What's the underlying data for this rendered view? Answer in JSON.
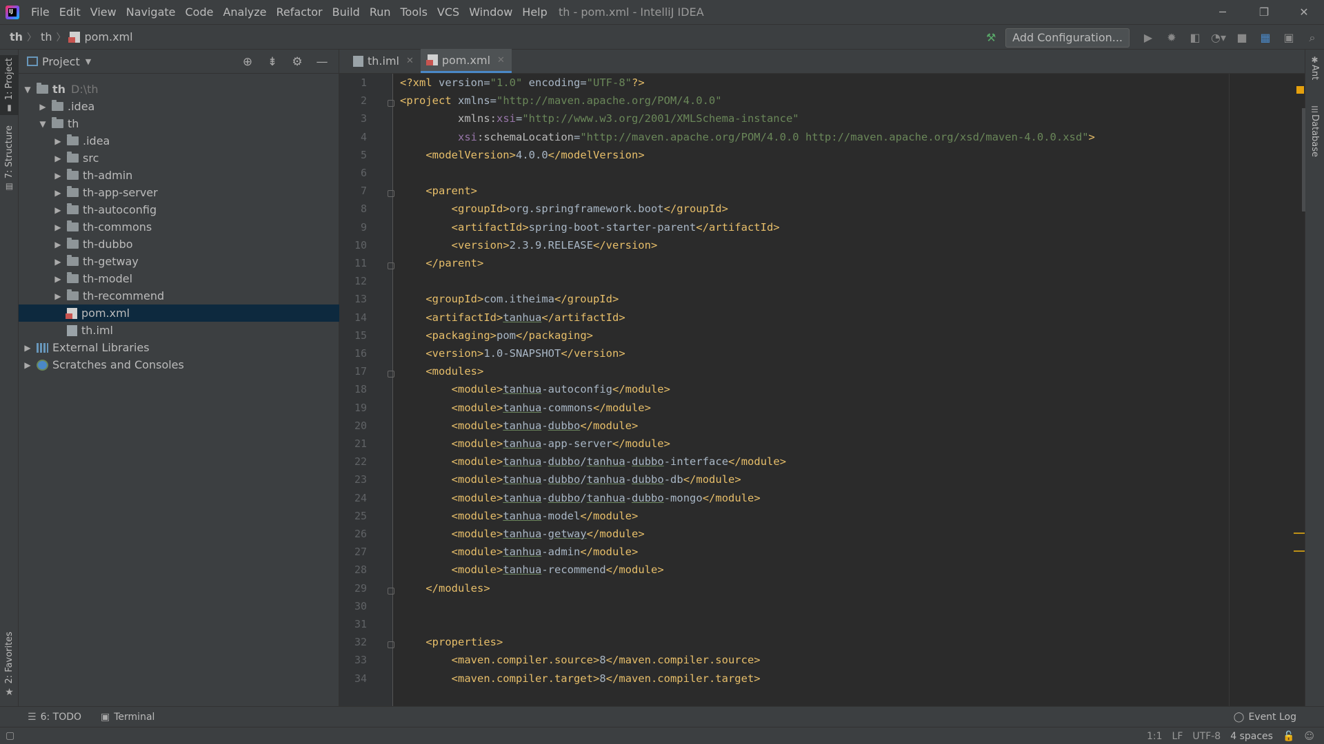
{
  "window": {
    "title": "th - pom.xml - IntelliJ IDEA",
    "logo_text": "IJ",
    "controls": [
      "─",
      "❐",
      "✕"
    ]
  },
  "menu": [
    {
      "label": "File"
    },
    {
      "label": "Edit"
    },
    {
      "label": "View"
    },
    {
      "label": "Navigate"
    },
    {
      "label": "Code"
    },
    {
      "label": "Analyze"
    },
    {
      "label": "Refactor"
    },
    {
      "label": "Build"
    },
    {
      "label": "Run"
    },
    {
      "label": "Tools"
    },
    {
      "label": "VCS"
    },
    {
      "label": "Window"
    },
    {
      "label": "Help"
    }
  ],
  "breadcrumb": {
    "root": "th",
    "folder": "th",
    "file": "pom.xml"
  },
  "toolbar": {
    "add_configuration": "Add Configuration..."
  },
  "left_strip": {
    "project": "1: Project",
    "structure": "7: Structure",
    "favorites": "2: Favorites"
  },
  "right_strip": {
    "ant": "Ant",
    "database": "Database"
  },
  "project_panel": {
    "title": "Project",
    "tree": [
      {
        "label": "th",
        "hint": "D:\\th",
        "type": "folder",
        "level": 0,
        "expanded": true
      },
      {
        "label": ".idea",
        "type": "folder",
        "level": 1,
        "expanded": false
      },
      {
        "label": "th",
        "type": "folder",
        "level": 1,
        "expanded": true
      },
      {
        "label": ".idea",
        "type": "folder",
        "level": 2,
        "expanded": false
      },
      {
        "label": "src",
        "type": "folder",
        "level": 2,
        "expanded": false
      },
      {
        "label": "th-admin",
        "type": "folder",
        "level": 2,
        "expanded": false
      },
      {
        "label": "th-app-server",
        "type": "folder",
        "level": 2,
        "expanded": false
      },
      {
        "label": "th-autoconfig",
        "type": "folder",
        "level": 2,
        "expanded": false
      },
      {
        "label": "th-commons",
        "type": "folder",
        "level": 2,
        "expanded": false
      },
      {
        "label": "th-dubbo",
        "type": "folder",
        "level": 2,
        "expanded": false
      },
      {
        "label": "th-getway",
        "type": "folder",
        "level": 2,
        "expanded": false
      },
      {
        "label": "th-model",
        "type": "folder",
        "level": 2,
        "expanded": false
      },
      {
        "label": "th-recommend",
        "type": "folder",
        "level": 2,
        "expanded": false
      },
      {
        "label": "pom.xml",
        "type": "xml",
        "level": 2,
        "selected": true
      },
      {
        "label": "th.iml",
        "type": "iml",
        "level": 2
      },
      {
        "label": "External Libraries",
        "type": "lib",
        "level": 0,
        "expanded": false
      },
      {
        "label": "Scratches and Consoles",
        "type": "scratch",
        "level": 0,
        "expanded": false
      }
    ]
  },
  "editor": {
    "tabs": [
      {
        "label": "th.iml",
        "active": false
      },
      {
        "label": "pom.xml",
        "active": true
      }
    ],
    "line_numbers": [
      "1",
      "2",
      "3",
      "4",
      "5",
      "6",
      "7",
      "8",
      "9",
      "10",
      "11",
      "12",
      "13",
      "14",
      "15",
      "16",
      "17",
      "18",
      "19",
      "20",
      "21",
      "22",
      "23",
      "24",
      "25",
      "26",
      "27",
      "28",
      "29",
      "30",
      "31",
      "32",
      "33",
      "34"
    ],
    "lines": [
      "<?xml version=\"1.0\" encoding=\"UTF-8\"?>",
      "<project xmlns=\"http://maven.apache.org/POM/4.0.0\"",
      "         xmlns:xsi=\"http://www.w3.org/2001/XMLSchema-instance\"",
      "         xsi:schemaLocation=\"http://maven.apache.org/POM/4.0.0 http://maven.apache.org/xsd/maven-4.0.0.xsd\">",
      "    <modelVersion>4.0.0</modelVersion>",
      "",
      "    <parent>",
      "        <groupId>org.springframework.boot</groupId>",
      "        <artifactId>spring-boot-starter-parent</artifactId>",
      "        <version>2.3.9.RELEASE</version>",
      "    </parent>",
      "",
      "    <groupId>com.itheima</groupId>",
      "    <artifactId>tanhua</artifactId>",
      "    <packaging>pom</packaging>",
      "    <version>1.0-SNAPSHOT</version>",
      "    <modules>",
      "        <module>tanhua-autoconfig</module>",
      "        <module>tanhua-commons</module>",
      "        <module>tanhua-dubbo</module>",
      "        <module>tanhua-app-server</module>",
      "        <module>tanhua-dubbo/tanhua-dubbo-interface</module>",
      "        <module>tanhua-dubbo/tanhua-dubbo-db</module>",
      "        <module>tanhua-dubbo/tanhua-dubbo-mongo</module>",
      "        <module>tanhua-model</module>",
      "        <module>tanhua-getway</module>",
      "        <module>tanhua-admin</module>",
      "        <module>tanhua-recommend</module>",
      "    </modules>",
      "",
      "",
      "    <properties>",
      "        <maven.compiler.source>8</maven.compiler.source>",
      "        <maven.compiler.target>8</maven.compiler.target>"
    ]
  },
  "bottom_tools": {
    "todo": "6: TODO",
    "terminal": "Terminal",
    "event_log": "Event Log"
  },
  "status_bar": {
    "position": "1:1",
    "line_sep": "LF",
    "encoding": "UTF-8",
    "indent": "4 spaces"
  },
  "colors": {
    "tag": "#e8bf6a",
    "string": "#6a8759",
    "namespace": "#9876aa",
    "text": "#a9b7c6",
    "selection": "#0d293e",
    "accent": "#4a88c7"
  }
}
